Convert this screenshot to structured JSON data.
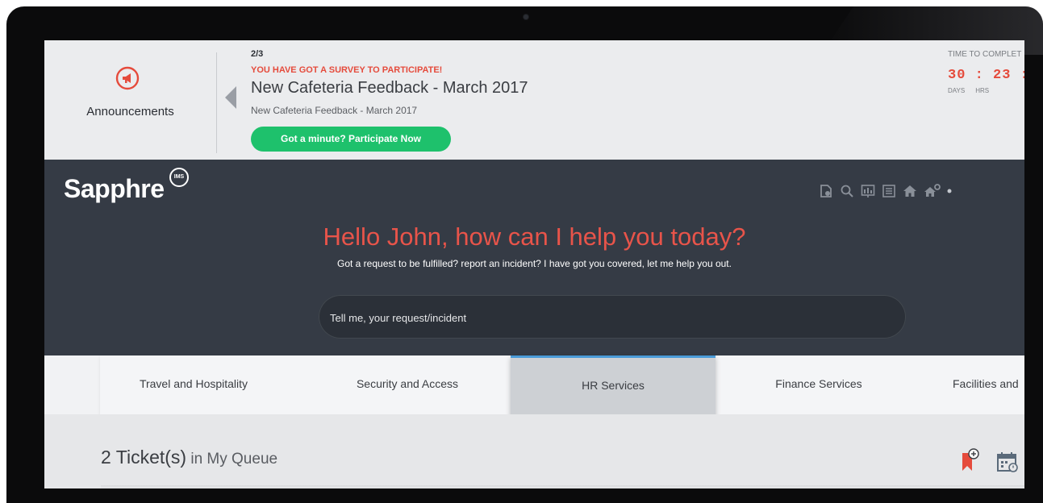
{
  "announcement": {
    "section_title": "Announcements",
    "counter": "2/3",
    "survey_label": "YOU HAVE GOT A SURVEY TO PARTICIPATE!",
    "headline": "New Cafeteria Feedback - March 2017",
    "subline": "New Cafeteria Feedback - March 2017",
    "cta_label": "Got a minute? Participate Now",
    "time_to_complete": {
      "label": "TIME TO COMPLET",
      "values": "30 : 23 :",
      "unit_days": "DAYS",
      "unit_hrs": "HRS"
    }
  },
  "hero": {
    "logo_text": "Sapphre",
    "logo_badge": "IMS",
    "greeting_name": "Hello John,",
    "greeting_rest": " how can I help you today?",
    "subtitle": "Got a request to be fulfilled? report an incident? I have got you covered, let me help you out.",
    "search_placeholder": "Tell me, your request/incident",
    "toolbar_icons": [
      "new-document-icon",
      "search-icon",
      "dashboard-icon",
      "list-icon",
      "home-icon",
      "home-settings-icon"
    ]
  },
  "tabs": [
    {
      "label": "Travel and Hospitality",
      "active": false
    },
    {
      "label": "Security and Access",
      "active": false
    },
    {
      "label": "HR Services",
      "active": true
    },
    {
      "label": "Finance Services",
      "active": false
    },
    {
      "label": "Facilities and",
      "active": false
    }
  ],
  "queue": {
    "count_label": "2 Ticket(s)",
    "location_label": " in My Queue",
    "icons": [
      "add-bookmark-icon",
      "calendar-icon"
    ]
  },
  "colors": {
    "accent_red": "#e54b3c",
    "cta_green": "#1ec16c",
    "hero_bg": "#353b45",
    "tab_active_border": "#4a9bd8"
  }
}
